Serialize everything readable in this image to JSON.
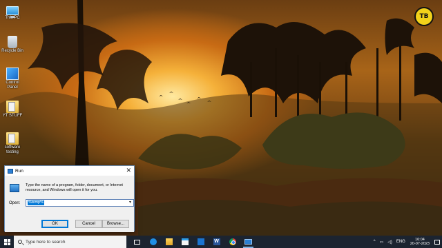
{
  "desktop": {
    "icons": [
      {
        "label": "This PC",
        "icon": "this-pc-icon"
      },
      {
        "label": "Recycle Bin",
        "icon": "recycle-bin-icon"
      },
      {
        "label": "Control Panel",
        "icon": "control-panel-icon"
      },
      {
        "label": "YT STUFF",
        "icon": "folder-icon"
      },
      {
        "label": "software testing",
        "icon": "folder-icon"
      }
    ],
    "logo_text": "TB"
  },
  "run_dialog": {
    "title": "Run",
    "close_glyph": "✕",
    "description": "Type the name of a program, folder, document, or Internet resource, and Windows will open it for you.",
    "open_label": "Open:",
    "open_value": "%temp%",
    "ok_label": "OK",
    "cancel_label": "Cancel",
    "browse_label": "Browse..."
  },
  "taskbar": {
    "search_placeholder": "Type here to search",
    "apps": [
      "task-view-icon",
      "edge-icon",
      "file-explorer-icon",
      "store-icon",
      "mail-icon",
      "word-icon",
      "chrome-icon",
      "run-icon"
    ],
    "tray": {
      "chevron": "^",
      "language": "ENG",
      "time": "16:04",
      "date": "20-07-2023"
    }
  }
}
